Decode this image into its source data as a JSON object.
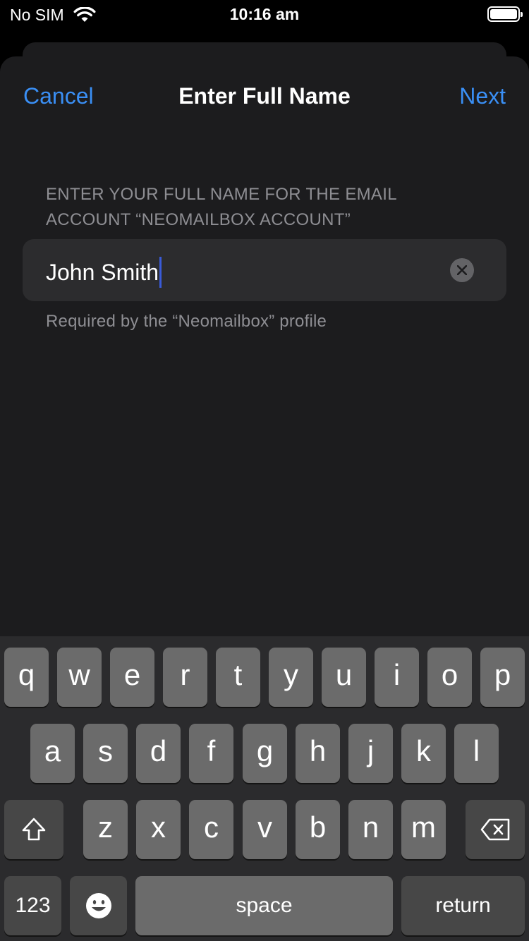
{
  "status_bar": {
    "carrier": "No SIM",
    "time": "10:16 am"
  },
  "nav": {
    "cancel_label": "Cancel",
    "title": "Enter Full Name",
    "next_label": "Next"
  },
  "form": {
    "header": "ENTER YOUR FULL NAME FOR THE EMAIL ACCOUNT “NEOMAILBOX ACCOUNT”",
    "name_value": "John Smith",
    "footer": "Required by the “Neomailbox” profile"
  },
  "keyboard": {
    "row1": [
      "q",
      "w",
      "e",
      "r",
      "t",
      "y",
      "u",
      "i",
      "o",
      "p"
    ],
    "row2": [
      "a",
      "s",
      "d",
      "f",
      "g",
      "h",
      "j",
      "k",
      "l"
    ],
    "row3": [
      "z",
      "x",
      "c",
      "v",
      "b",
      "n",
      "m"
    ],
    "numbers_label": "123",
    "space_label": "space",
    "return_label": "return"
  },
  "colors": {
    "accent": "#3a8ff5",
    "sheet_background": "#1c1c1e",
    "field_background": "#2c2c2e",
    "secondary_text": "#8e8e93"
  }
}
